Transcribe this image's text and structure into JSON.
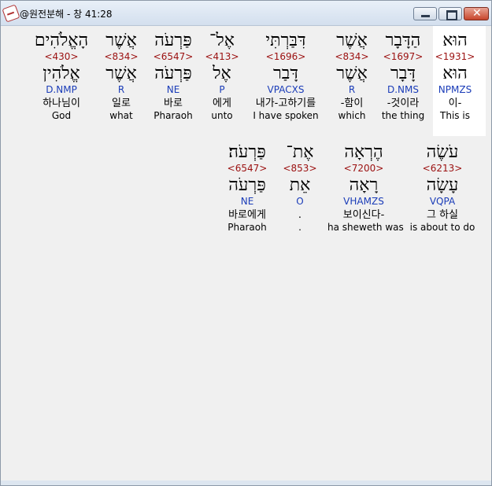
{
  "window": {
    "title": "@원전분해 - 창 41:28"
  },
  "icons": {
    "app": "verse-app-icon",
    "minimize": "minimize-icon",
    "maximize": "maximize-icon",
    "close": "close-icon"
  },
  "rows": [
    [
      {
        "heb": "הוּא",
        "strong": "<1931>",
        "lemma": "הוּא",
        "morph": "NPMZS",
        "kor": "이-",
        "eng": "This is",
        "highlight": true
      },
      {
        "heb": "הַדָּבָר",
        "strong": "<1697>",
        "lemma": "דָּבָר",
        "morph": "D.NMS",
        "kor": "-것이라",
        "eng": "the thing"
      },
      {
        "heb": "אֲשֶׁר",
        "strong": "<834>",
        "lemma": "אֲשֶׁר",
        "morph": "R",
        "kor": "-함이",
        "eng": "which"
      },
      {
        "heb": "דִּבַּרְתִּי",
        "strong": "<1696>",
        "lemma": "דָּבַר",
        "morph": "VPACXS",
        "kor": "내가-고하기를",
        "eng": "I have spoken"
      },
      {
        "heb": "אֶל־",
        "strong": "<413>",
        "lemma": "אֶל",
        "morph": "P",
        "kor": "에게",
        "eng": "unto"
      },
      {
        "heb": "פַּרְעֹה",
        "strong": "<6547>",
        "lemma": "פַּרְעֹה",
        "morph": "NE",
        "kor": "바로",
        "eng": "Pharaoh"
      },
      {
        "heb": "אֲשֶׁר",
        "strong": "<834>",
        "lemma": "אֲשֶׁר",
        "morph": "R",
        "kor": "일로",
        "eng": "what"
      },
      {
        "heb": "הָאֱלֹהִים",
        "strong": "<430>",
        "lemma": "אֱלֹהִין",
        "morph": "D.NMP",
        "kor": "하나님이",
        "eng": "God"
      }
    ],
    [
      {
        "heb": "עֹשֶׂה",
        "strong": "<6213>",
        "lemma": "עָשָׂה",
        "morph": "VQPA",
        "kor": "그 하실",
        "eng": "is about to do"
      },
      {
        "heb": "הֶרְאָה",
        "strong": "<7200>",
        "lemma": "רָאָה",
        "morph": "VHAMZS",
        "kor": "보이신다-",
        "eng": "ha sheweth was"
      },
      {
        "heb": "אֶת־",
        "strong": "<853>",
        "lemma": "אֵת",
        "morph": "O",
        "kor": ".",
        "eng": "."
      },
      {
        "heb": "פַּרְעֹה׃",
        "strong": "<6547>",
        "lemma": "פַּרְעֹה",
        "morph": "NE",
        "kor": "바로에게",
        "eng": "Pharaoh"
      }
    ]
  ]
}
